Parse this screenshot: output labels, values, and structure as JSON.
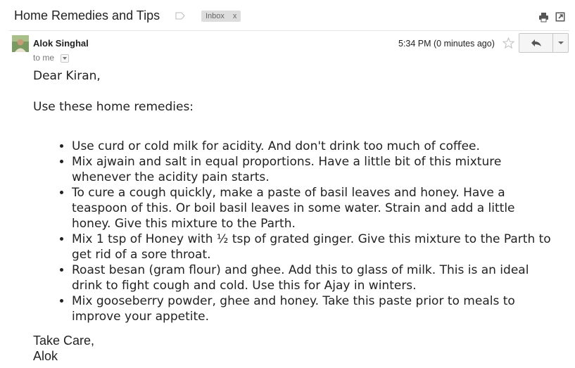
{
  "header": {
    "subject": "Home Remedies and Tips",
    "label_chip": {
      "text": "Inbox",
      "remove": "x"
    }
  },
  "message": {
    "sender": "Alok Singhal",
    "recipient": "to me",
    "timestamp": "5:34 PM (0 minutes ago)"
  },
  "body": {
    "greeting": "Dear Kiran,",
    "intro": "Use these home remedies:",
    "remedies": [
      "Use curd or cold milk for acidity. And don't drink too much of coffee.",
      "Mix ajwain and salt in equal proportions. Have a little bit of this mixture whenever the acidity pain starts.",
      "To cure a cough quickly, make a paste of basil leaves and honey. Have a teaspoon of this. Or boil basil leaves in some water. Strain and add a little honey. Give this mixture to the Parth.",
      "Mix 1 tsp of Honey with ½ tsp of grated ginger. Give this mixture to the Parth to get rid of a sore throat.",
      "Roast besan (gram flour) and ghee. Add this to glass of milk. This is an ideal drink to fight cough and cold. Use this for Ajay in winters.",
      "Mix gooseberry powder, ghee and honey. Take this paste prior to meals to improve your appetite."
    ],
    "closing": "Take Care,",
    "signature": "Alok"
  },
  "icons": {
    "label": "label-icon",
    "print": "print-icon",
    "new_window": "new-window-icon",
    "star": "star-icon",
    "reply": "reply-icon",
    "more": "chevron-down-icon"
  },
  "colors": {
    "label_chip_bg": "#dddddd",
    "button_bg": "#f5f5f5"
  }
}
